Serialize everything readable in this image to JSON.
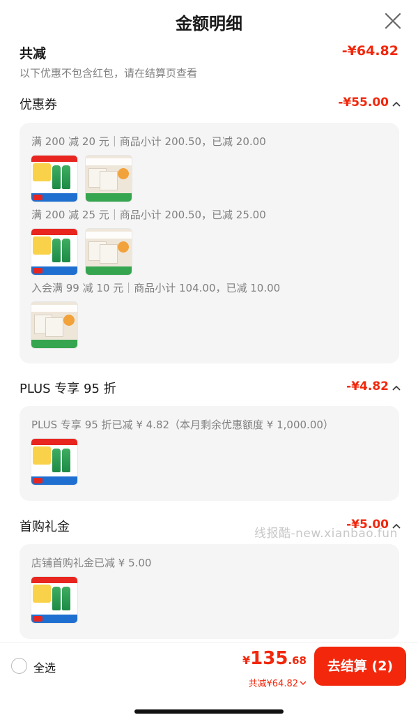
{
  "header": {
    "title": "金额明细"
  },
  "total": {
    "label": "共减",
    "amount": "-¥64.82",
    "note": "以下优惠不包含红包，请在结算页查看"
  },
  "sections": {
    "coupon": {
      "title": "优惠券",
      "amount": "-¥55.00",
      "rules": [
        "满 200 减 20 元｜商品小计 200.50，已减 20.00",
        "满 200 减 25 元｜商品小计 200.50，已减 25.00",
        "入会满 99 减 10 元｜商品小计 104.00，已减 10.00"
      ]
    },
    "plus": {
      "title": "PLUS 专享 95 折",
      "amount": "-¥4.82",
      "rules": [
        "PLUS 专享 95 折已减 ¥ 4.82（本月剩余优惠额度 ¥ 1,000.00）"
      ]
    },
    "gift": {
      "title": "首购礼金",
      "amount": "-¥5.00",
      "rules": [
        "店铺首购礼金已减 ¥ 5.00"
      ]
    }
  },
  "watermark": "线报酷-new.xianbao.fun",
  "footer": {
    "select_all": "全选",
    "price_currency": "¥",
    "price_int": "135",
    "price_dec": ".68",
    "discount": "共减¥64.82",
    "checkout": "去结算 (2)"
  },
  "icons": [
    "close-icon",
    "caret-up-icon",
    "radio-icon",
    "chevron-down-icon"
  ],
  "colors": {
    "accent": "#f2270c",
    "card_bg": "#f5f5f5",
    "muted_text": "#808080"
  }
}
